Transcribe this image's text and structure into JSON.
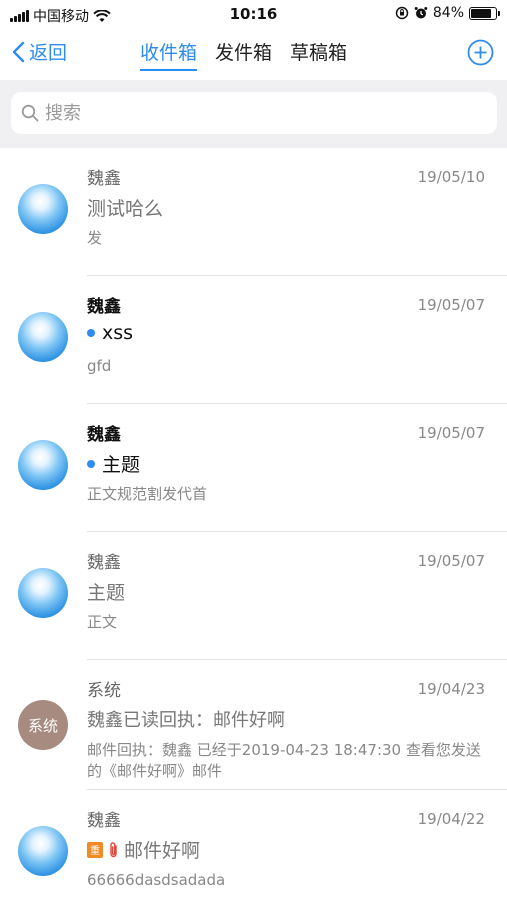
{
  "status_bar": {
    "carrier": "中国移动",
    "time": "10:16",
    "battery_percent": "84%",
    "battery_level": 0.84
  },
  "nav": {
    "back_label": "返回",
    "tabs": [
      {
        "label": "收件箱",
        "active": true
      },
      {
        "label": "发件箱",
        "active": false
      },
      {
        "label": "草稿箱",
        "active": false
      }
    ]
  },
  "search": {
    "placeholder": "搜索"
  },
  "emails": [
    {
      "sender": "魏鑫",
      "date": "19/05/10",
      "subject": "测试哈么",
      "preview": "发",
      "unread": false,
      "avatar": "sky"
    },
    {
      "sender": "魏鑫",
      "date": "19/05/07",
      "subject": "xss",
      "preview": "gfd",
      "unread": true,
      "avatar": "sky"
    },
    {
      "sender": "魏鑫",
      "date": "19/05/07",
      "subject": "主题",
      "preview": "正文规范割发代首",
      "unread": true,
      "avatar": "sky"
    },
    {
      "sender": "魏鑫",
      "date": "19/05/07",
      "subject": "主题",
      "preview": "正文",
      "unread": false,
      "avatar": "sky"
    },
    {
      "sender": "系统",
      "date": "19/04/23",
      "subject": "魏鑫已读回执：邮件好啊",
      "preview": "邮件回执：魏鑫 已经于2019-04-23 18:47:30 查看您发送的《邮件好啊》邮件",
      "unread": false,
      "avatar": "system",
      "avatar_text": "系统"
    },
    {
      "sender": "魏鑫",
      "date": "19/04/22",
      "subject": "邮件好啊",
      "preview": "66666dasdsadada",
      "unread": false,
      "avatar": "sky",
      "important_badge": "重",
      "has_attachment": true
    }
  ],
  "colors": {
    "accent": "#2d8cf0",
    "search_band": "#f0f0f2",
    "important_badge": "#f08a24",
    "system_avatar": "#a78a80"
  }
}
